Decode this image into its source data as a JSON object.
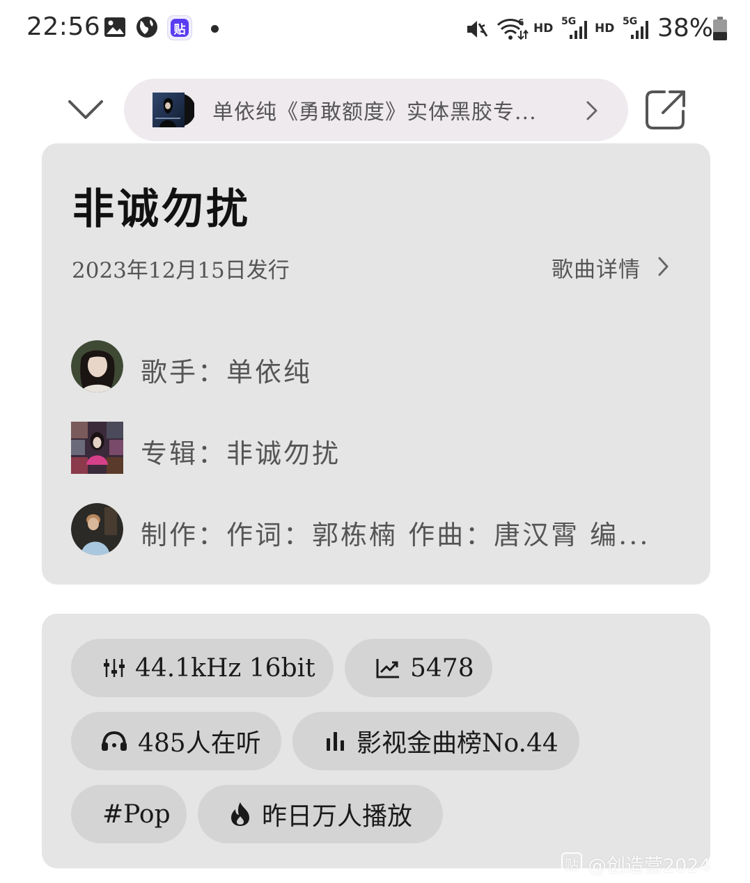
{
  "status_bar": {
    "time": "22:56",
    "left_icons": [
      "gallery-icon",
      "globe-icon",
      "tieba-icon",
      "dot-icon"
    ],
    "tieba_badge": "贴",
    "right_icons": [
      "mute-icon",
      "wifi-icon",
      "signal-5g-icon",
      "signal-5g-icon",
      "battery-icon"
    ],
    "hd_label": "HD",
    "fiveg_label": "5G",
    "battery_percent": "38%"
  },
  "header": {
    "collapse_icon": "chevron-down-icon",
    "album_link_text": "单依纯《勇敢额度》实体黑胶专...",
    "album_link_icon": "chevron-right-icon",
    "share_icon": "share-icon"
  },
  "song": {
    "title": "非诚勿扰",
    "release_date": "2023年12月15日发行",
    "detail_link": "歌曲详情",
    "singer_row": "歌手：单依纯",
    "album_row": "专辑：非诚勿扰",
    "credits_row": "制作：作词：郭栋楠  作曲：唐汉霄  编..."
  },
  "tags": [
    {
      "icon": "equalizer-icon",
      "label": "44.1kHz   16bit"
    },
    {
      "icon": "trend-up-icon",
      "label": "5478"
    },
    {
      "icon": "headphones-icon",
      "label": "485人在听"
    },
    {
      "icon": "bar-chart-icon",
      "label": "影视金曲榜No.44"
    },
    {
      "icon": "",
      "label": "#Pop"
    },
    {
      "icon": "fire-icon",
      "label": "昨日万人播放"
    }
  ],
  "watermark": {
    "badge": "贴",
    "text": "@创造营2024"
  },
  "colors": {
    "card_bg": "#e5e5e5",
    "tag_bg": "#d4d4d4",
    "pill_bg": "#efeaee",
    "tieba_purple": "#5a3cf0"
  }
}
